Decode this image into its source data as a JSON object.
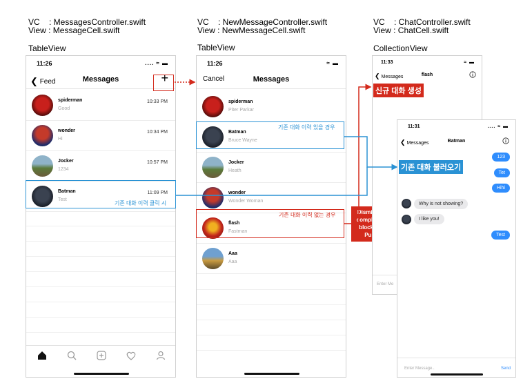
{
  "captions": {
    "col1_vc": "VC    : MessagesController.swift",
    "col1_view": "View : MessageCell.swift",
    "col1_sub": "TableView",
    "col2_vc": "VC    : NewMessageController.swift",
    "col2_view": "View : NewMessageCell.swift",
    "col2_sub": "TableView",
    "col3_vc": "VC    : ChatController.swift",
    "col3_view": "View : ChatCell.swift",
    "col3_sub": "CollectionView"
  },
  "screen1": {
    "time": "11:26",
    "status_icons": "....  ≈  ▬",
    "back_label": "Feed",
    "title": "Messages",
    "add_icon": "+",
    "rows": [
      {
        "name": "spiderman",
        "sub": "Good",
        "time": "10:33 PM"
      },
      {
        "name": "wonder",
        "sub": "Hi",
        "time": "10:34 PM"
      },
      {
        "name": "Jocker",
        "sub": "1234",
        "time": "10:57 PM"
      },
      {
        "name": "Batman",
        "sub": "Test",
        "time": "11:09 PM"
      }
    ],
    "annotation": "기존 대화 이력 클릭 시"
  },
  "screen2": {
    "time": "11:26",
    "status_icons": "≈  ▬",
    "cancel_label": "Cancel",
    "title": "Messages",
    "rows": [
      {
        "name": "spiderman",
        "sub": "Piter Parkar"
      },
      {
        "name": "Batman",
        "sub": "Bruce Wayne"
      },
      {
        "name": "Jocker",
        "sub": "Heath"
      },
      {
        "name": "wonder",
        "sub": "Wonder Woman"
      },
      {
        "name": "flash",
        "sub": "Fastman"
      },
      {
        "name": "Aaa",
        "sub": "Aaa"
      }
    ],
    "annotation_existing": "기존 대화 이력 있을 경우",
    "annotation_new": "기존 대화 이력 없는 경우"
  },
  "dismiss_note": "Dismiss 후\ncompletion\nblock으로\nPush",
  "label_new_chat": "신규 대화 생성",
  "label_load_chat": "기존 대화 불러오기",
  "screen3_back": {
    "time": "11:33",
    "status_icons": "≈  ▬",
    "back_label": "Messages",
    "title": "flash",
    "input_placeholder": "Enter Me"
  },
  "screen3_front": {
    "time": "11:31",
    "status_icons": "....  ≈  ▬",
    "back_label": "Messages",
    "title": "Batman",
    "sent": [
      "123",
      "Tet",
      "Hihi",
      "Test"
    ],
    "received": [
      "Why is not showing?",
      "I like you!"
    ],
    "input_placeholder": "Enter Message..",
    "send_label": "Send"
  },
  "colors": {
    "red": "#d32a1c",
    "blue": "#2a92d4",
    "bubble": "#2f8dfd"
  }
}
